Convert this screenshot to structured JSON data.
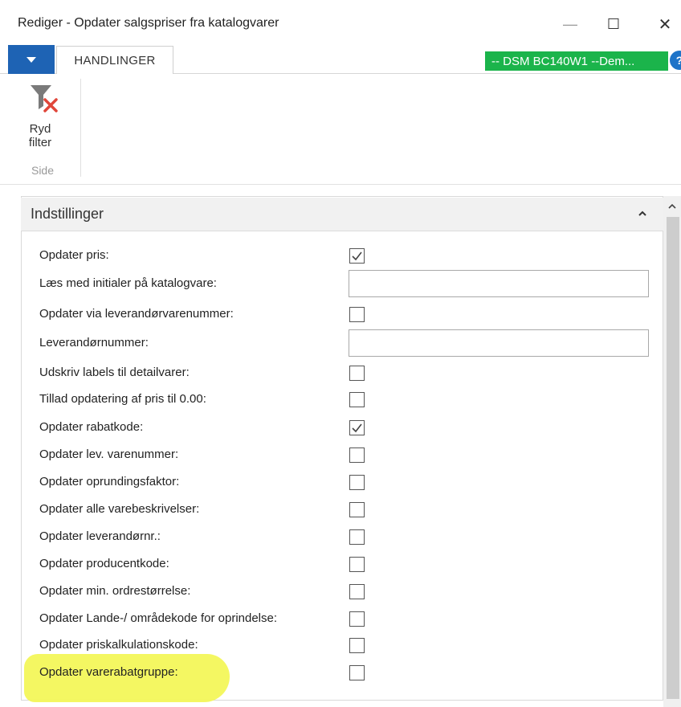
{
  "window": {
    "title": "Rediger - Opdater salgspriser fra katalogvarer",
    "min_glyph": "—",
    "max_glyph": "☐",
    "close_glyph": "✕"
  },
  "ribbon": {
    "tab_label": "HANDLINGER",
    "company_label": "-- DSM BC140W1 --Dem...",
    "help_glyph": "?",
    "action": {
      "label_line1": "Ryd",
      "label_line2": "filter",
      "icon": "clear-filter-icon"
    },
    "group_label": "Side"
  },
  "section": {
    "title": "Indstillinger",
    "collapse_icon": "chevron-up-icon"
  },
  "fields": [
    {
      "label": "Opdater pris:",
      "type": "checkbox",
      "checked": true
    },
    {
      "label": "Læs med initialer på katalogvare:",
      "type": "text",
      "value": ""
    },
    {
      "label": "Opdater via leverandørvarenummer:",
      "type": "checkbox",
      "checked": false
    },
    {
      "label": "Leverandørnummer:",
      "type": "text",
      "value": ""
    },
    {
      "label": "Udskriv labels til detailvarer:",
      "type": "checkbox",
      "checked": false
    },
    {
      "label": "Tillad opdatering af pris til 0.00:",
      "type": "checkbox",
      "checked": false
    },
    {
      "label": "Opdater rabatkode:",
      "type": "checkbox",
      "checked": true
    },
    {
      "label": "Opdater lev. varenummer:",
      "type": "checkbox",
      "checked": false
    },
    {
      "label": "Opdater oprundingsfaktor:",
      "type": "checkbox",
      "checked": false
    },
    {
      "label": "Opdater alle varebeskrivelser:",
      "type": "checkbox",
      "checked": false
    },
    {
      "label": "Opdater leverandørnr.:",
      "type": "checkbox",
      "checked": false
    },
    {
      "label": "Opdater producentkode:",
      "type": "checkbox",
      "checked": false
    },
    {
      "label": "Opdater min. ordrestørrelse:",
      "type": "checkbox",
      "checked": false
    },
    {
      "label": "Opdater Lande-/ områdekode for oprindelse:",
      "type": "checkbox",
      "checked": false
    },
    {
      "label": "Opdater priskalkulationskode:",
      "type": "checkbox",
      "checked": false
    },
    {
      "label": "Opdater varerabatgruppe:",
      "type": "checkbox",
      "checked": false,
      "highlighted": true
    }
  ],
  "colors": {
    "menu_button": "#1e63b4",
    "company_badge": "#1bb44b",
    "highlight": "#f3f75a"
  }
}
